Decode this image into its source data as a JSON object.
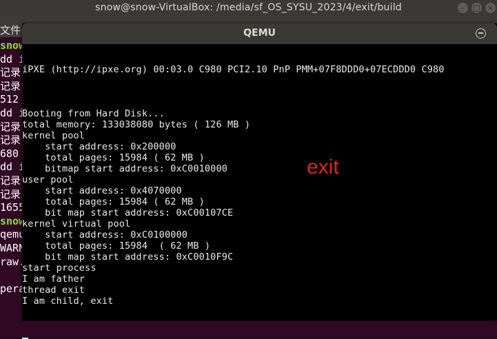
{
  "terminal": {
    "title": "snow@snow-VirtualBox: /media/sf_OS_SYSU_2023/4/exit/build",
    "menu_file": "文件",
    "lines": [
      {
        "text": "snow",
        "style": "green"
      },
      {
        "text": "dd i",
        "style": "plain"
      },
      {
        "text": "记录",
        "style": "plain"
      },
      {
        "text": "记录",
        "style": "plain"
      },
      {
        "text": "512",
        "style": "plain"
      },
      {
        "text": "dd i",
        "style": "plain"
      },
      {
        "text": "记录",
        "style": "plain"
      },
      {
        "text": "记录",
        "style": "plain"
      },
      {
        "text": "680",
        "style": "plain"
      },
      {
        "text": "dd i",
        "style": "plain"
      },
      {
        "text": "记录",
        "style": "plain"
      },
      {
        "text": "记录",
        "style": "plain"
      },
      {
        "text": "1655",
        "style": "plain"
      },
      {
        "text": "snow",
        "style": "green"
      },
      {
        "text": "qemu",
        "style": "plain"
      },
      {
        "text": "WARN",
        "style": "plain"
      },
      {
        "text": "raw.",
        "style": "plain"
      },
      {
        "text": "",
        "style": "plain"
      },
      {
        "text": "pera",
        "style": "plain"
      }
    ]
  },
  "qemu": {
    "title": "QEMU",
    "console_lines": [
      "iPXE (http://ipxe.org) 00:03.0 C980 PCI2.10 PnP PMM+07F8DDD0+07ECDDD0 C980",
      "",
      "",
      "",
      "Booting from Hard Disk...",
      "total memory: 133038080 bytes ( 126 MB )",
      "kernel pool",
      "    start address: 0x200000",
      "    total pages: 15984 ( 62 MB )",
      "    bitmap start address: 0xC0010000",
      "user pool",
      "    start address: 0x4070000",
      "    total pages: 15984 ( 62 MB )",
      "    bit map start address: 0xC00107CE",
      "kernel virtual pool",
      "    start address: 0xC0100000",
      "    total pages: 15984  ( 62 MB )",
      "    bit map start address: 0xC0010F9C",
      "start process",
      "I am father",
      "thread exit",
      "I am child, exit"
    ]
  },
  "annotation": {
    "label": "exit",
    "color": "#e2231a"
  }
}
